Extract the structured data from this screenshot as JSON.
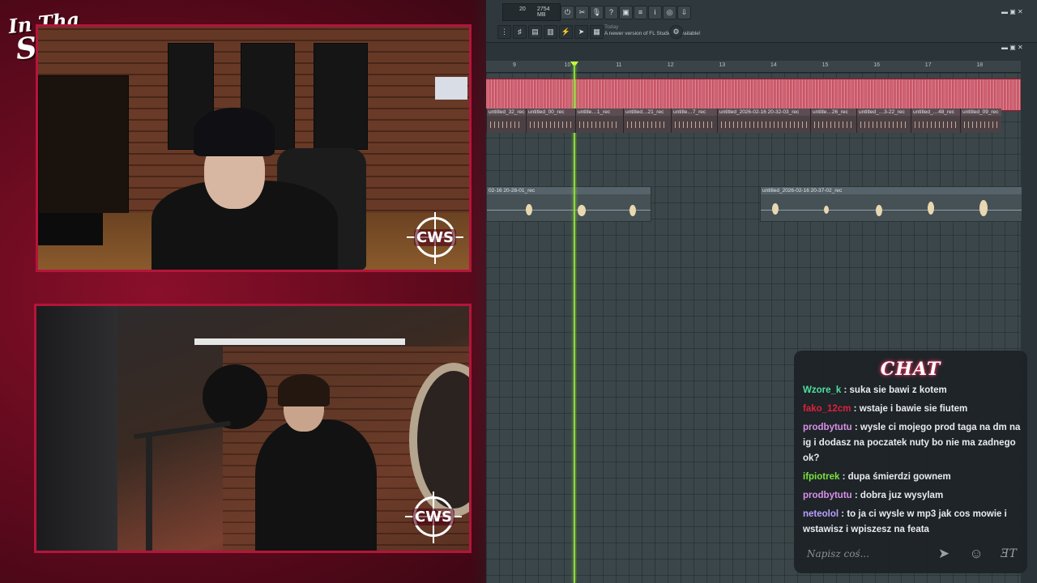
{
  "overlay": {
    "logo_line1": "In Tha",
    "logo_line2": "Studio!",
    "watermark": "CWS"
  },
  "daw": {
    "cpu_value": "20",
    "memory_label": "2754 MB",
    "memory_sub": "3",
    "news_day": "Today",
    "news_text": "A newer version of FL Studio is available!",
    "ruler_bars": [
      "9",
      "10",
      "11",
      "12",
      "13",
      "14",
      "15",
      "16",
      "17",
      "18"
    ],
    "clip_labels": [
      "untitled_32_rec",
      "untitled_00_rec",
      "untitle…1_rec",
      "untitled…21_rec",
      "untitle…7_rec",
      "untitled_2026-02-16 20-32-03_rec",
      "untitle…26_rec",
      "untitled_…3-22_rec",
      "untitled_…48_rec",
      "untitled_09_rec"
    ],
    "long_clip_1": "02-16 20-28-01_rec",
    "long_clip_2": "untitled_2026-02-16 20-37-02_rec"
  },
  "chat": {
    "title": "CHAT",
    "input_placeholder": "Napisz coś...",
    "messages": [
      {
        "user": "Wzore_k",
        "color": "#4ee0a0",
        "text": "suka sie bawi z kotem"
      },
      {
        "user": "fako_12cm",
        "color": "#e0203a",
        "text": "wstaje i bawie sie fiutem"
      },
      {
        "user": "prodbytutu",
        "color": "#d890e8",
        "text": "wysle ci mojego prod taga na dm na ig i dodasz na poczatek nuty bo nie ma zadnego ok?"
      },
      {
        "user": "ifpiotrek",
        "color": "#7be33a",
        "text": "dupa śmierdzi gownem"
      },
      {
        "user": "prodbytutu",
        "color": "#d890e8",
        "text": "dobra juz wysylam"
      },
      {
        "user": "neteolol",
        "color": "#b8a0ff",
        "text": "to ja ci wysle w mp3 jak cos mowie i wstawisz i wpiszesz na feata"
      }
    ]
  },
  "colors": {
    "frame_red": "#8a0f2a",
    "cam_border": "#b5153a",
    "playhead": "#8bdc3a",
    "wave": "#d96b7a"
  }
}
